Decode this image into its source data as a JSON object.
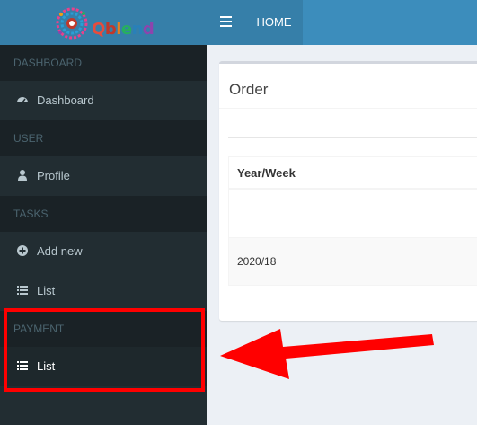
{
  "brand": {
    "name": "Qblend"
  },
  "topbar": {
    "toggle_icon": "hamburger-icon",
    "home_label": "HOME"
  },
  "sidebar": {
    "sections": [
      {
        "header": "DASHBOARD",
        "items": [
          {
            "label": "Dashboard",
            "icon": "dashboard-icon"
          }
        ]
      },
      {
        "header": "USER",
        "items": [
          {
            "label": "Profile",
            "icon": "user-icon"
          }
        ]
      },
      {
        "header": "TASKS",
        "items": [
          {
            "label": "Add new",
            "icon": "plus-circle-icon"
          },
          {
            "label": "List",
            "icon": "list-icon"
          }
        ]
      },
      {
        "header": "PAYMENT",
        "items": [
          {
            "label": "List",
            "icon": "list-icon"
          }
        ]
      }
    ]
  },
  "main": {
    "box_title": "Order",
    "table": {
      "columns": [
        "Year/Week"
      ],
      "rows": [
        [
          "2020/18"
        ]
      ]
    }
  },
  "annotation": {
    "highlight_color": "#ff0000"
  }
}
